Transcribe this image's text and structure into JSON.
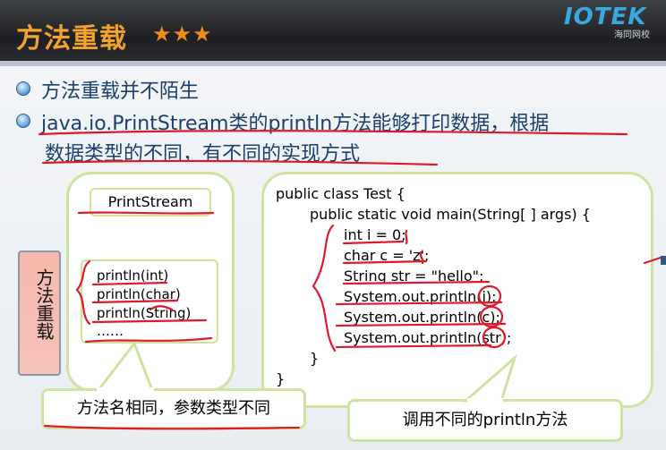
{
  "header": {
    "title": "方法重载",
    "stars": "★★★",
    "logo_text": "IOTEK",
    "logo_sub": "海同网校"
  },
  "bullets": [
    {
      "text": "方法重载并不陌生"
    },
    {
      "line1": "java.io.PrintStream类的println方法能够打印数据，根据",
      "line2": "数据类型的不同，有不同的实现方式"
    }
  ],
  "left_panel": {
    "class_name": "PrintStream",
    "methods": [
      "println(int)",
      "println(char)",
      "println(String)",
      "……"
    ]
  },
  "overload_tag": "方法重载",
  "code": [
    "public class Test {",
    "public static void main(String[ ] args) {",
    "int i = 0;",
    "char c = 'z';",
    "String str = \"hello\";",
    "System.out.println(i);",
    "System.out.println(c);",
    "System.out.println(str);",
    "}",
    "}"
  ],
  "callouts": {
    "left": "方法名相同，参数类型不同",
    "right": "调用不同的println方法"
  },
  "colors": {
    "title": "#f3a32c",
    "annotation": "#e0192a",
    "panel_border": "#cfe3a1",
    "bullet_text": "#1c3f6e"
  }
}
